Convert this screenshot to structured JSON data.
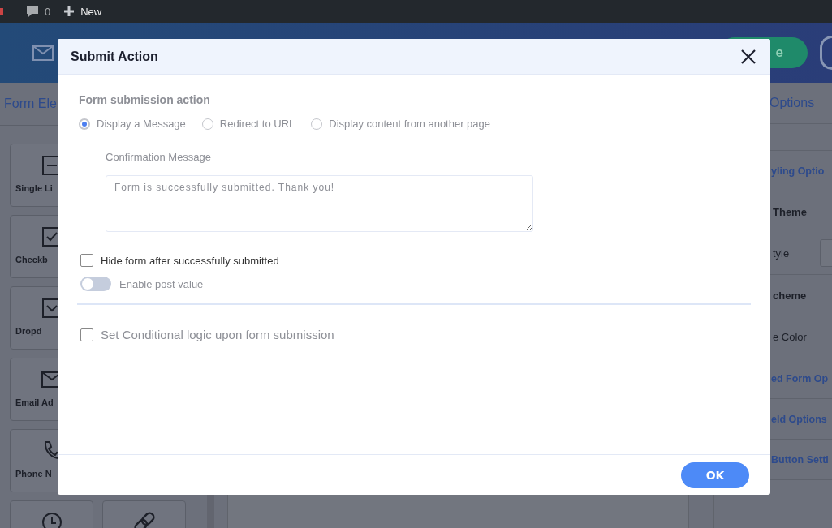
{
  "admin_bar": {
    "comments_count": "0",
    "new_label": "New"
  },
  "header": {
    "button_label": "e"
  },
  "left_panel": {
    "title": "Form Ele",
    "tiles": [
      {
        "kind": "line",
        "label": "Single Li"
      },
      {
        "kind": "checkbox",
        "label": "Checkb"
      },
      {
        "kind": "dropdown",
        "label": "Dropd"
      },
      {
        "kind": "email",
        "label": "Email Ad"
      },
      {
        "kind": "phone",
        "label": "Phone N"
      },
      {
        "kind": "clock"
      },
      {
        "kind": "link"
      }
    ]
  },
  "right_panel": {
    "title": "Options",
    "rows": [
      {
        "kind": "heading",
        "label": "yling Optio"
      },
      {
        "kind": "section",
        "label": "Theme"
      },
      {
        "kind": "select",
        "label": "tyle"
      },
      {
        "kind": "section",
        "label": "cheme"
      },
      {
        "kind": "toggle",
        "label": "e Color"
      },
      {
        "kind": "heading",
        "label": "ed Form Op"
      },
      {
        "kind": "heading",
        "label": "eld Options"
      },
      {
        "kind": "heading",
        "label": "Button Setti"
      }
    ]
  },
  "modal": {
    "title": "Submit Action",
    "section_label": "Form submission action",
    "disabled": true,
    "options": [
      {
        "label": "Display a Message",
        "selected": true
      },
      {
        "label": "Redirect to URL",
        "selected": false
      },
      {
        "label": "Display content from another page",
        "selected": false
      }
    ],
    "confirmation_label": "Confirmation Message",
    "confirmation_value": "Form is successfully submitted. Thank you!",
    "hide_form": {
      "label": "Hide form after successfully submitted",
      "checked": false
    },
    "post_value": {
      "label": "Enable post value",
      "on": false,
      "disabled": true
    },
    "conditional": {
      "label": "Set Conditional logic upon form submission",
      "checked": false,
      "disabled": true
    },
    "ok_label": "OK"
  }
}
